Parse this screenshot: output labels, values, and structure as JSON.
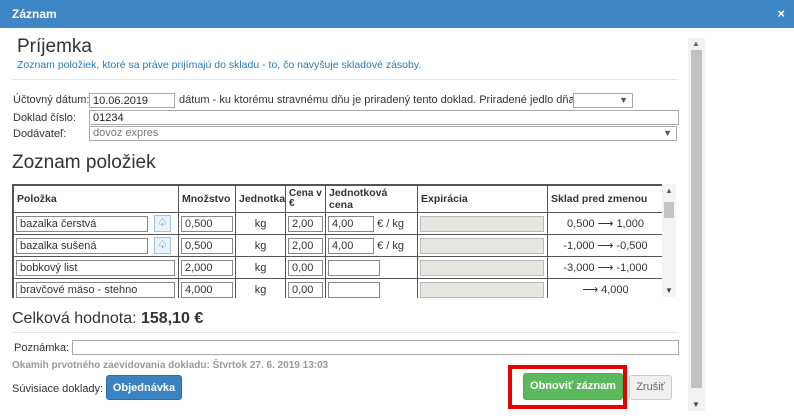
{
  "window": {
    "title": "Záznam",
    "close": "×"
  },
  "header": {
    "title": "Príjemka",
    "subtitle": "Zoznam položiek, ktoré sa práve prijímajú do skladu - to, čo navyšuje skladové zásoby."
  },
  "form": {
    "date_label": "Účtovný dátum:",
    "date_value": "10.06.2019",
    "date_hint": "dátum - ku ktorému stravnému dňu je priradený tento doklad. Priradené jedlo dňa:",
    "meal_value": "",
    "doc_label": "Doklad číslo:",
    "doc_value": "01234",
    "supplier_label": "Dodávateľ:",
    "supplier_value": "dovoz expres"
  },
  "items": {
    "title": "Zoznam položiek",
    "columns": [
      "Položka",
      "Množstvo",
      "Jednotka",
      "Cena v €",
      "Jednotková cena",
      "Expirácia",
      "Sklad pred zmenou"
    ],
    "rows": [
      {
        "name": "bazalka čerstvá",
        "bell": true,
        "qty": "0,500",
        "unit": "kg",
        "price": "2,00",
        "unit_price": "4,00",
        "unit_price_suffix": "€ / kg",
        "stock": "0,500 ⟶ 1,000"
      },
      {
        "name": "bazalka sušená",
        "bell": true,
        "qty": "0,500",
        "unit": "kg",
        "price": "2,00",
        "unit_price": "4,00",
        "unit_price_suffix": "€ / kg",
        "stock": "-1,000 ⟶ -0,500"
      },
      {
        "name": "bobkový list",
        "bell": false,
        "qty": "2,000",
        "unit": "kg",
        "price": "0,00",
        "unit_price": "",
        "unit_price_suffix": "",
        "stock": "-3,000 ⟶ -1,000"
      },
      {
        "name": "bravčové mäso - stehno",
        "bell": false,
        "qty": "4,000",
        "unit": "kg",
        "price": "0,00",
        "unit_price": "",
        "unit_price_suffix": "",
        "stock": "⟶ 4,000"
      }
    ]
  },
  "summary": {
    "total_label": "Celková hodnota:",
    "total_value": "158,10 €",
    "note_label": "Poznámka:",
    "note_value": "",
    "first_record": "Okamih prvotného zaevidovania dokladu: Štvrtok 27. 6. 2019 13:03"
  },
  "footer": {
    "related_label": "Súvisiace doklady:",
    "order_button": "Objednávka",
    "update_button": "Obnoviť záznam",
    "cancel_button": "Zrušiť"
  },
  "colors": {
    "titlebar": "#3f86c4",
    "primary_button": "#3a83c2",
    "success_button": "#5cb85c",
    "highlight": "#e60000"
  }
}
